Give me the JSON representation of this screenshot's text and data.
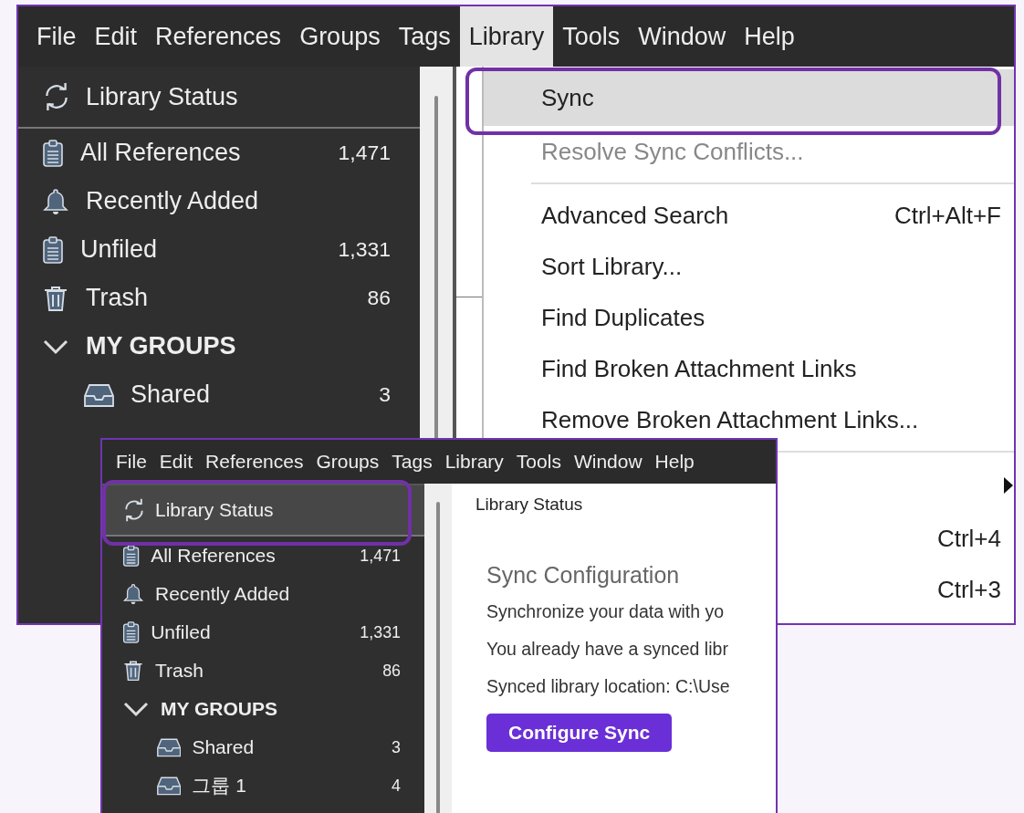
{
  "windows": [
    {
      "menubar": [
        {
          "label": "File",
          "selected": false
        },
        {
          "label": "Edit",
          "selected": false
        },
        {
          "label": "References",
          "selected": false
        },
        {
          "label": "Groups",
          "selected": false
        },
        {
          "label": "Tags",
          "selected": false
        },
        {
          "label": "Library",
          "selected": true
        },
        {
          "label": "Tools",
          "selected": false
        },
        {
          "label": "Window",
          "selected": false
        },
        {
          "label": "Help",
          "selected": false
        }
      ],
      "sidebar": {
        "status_item": {
          "label": "Library Status",
          "selected": false
        },
        "items": [
          {
            "kind": "all",
            "label": "All References",
            "count": "1,471"
          },
          {
            "kind": "recent",
            "label": "Recently Added"
          },
          {
            "kind": "unfiled",
            "label": "Unfiled",
            "count": "1,331"
          },
          {
            "kind": "trash",
            "label": "Trash",
            "count": "86"
          },
          {
            "kind": "header",
            "label": "MY GROUPS",
            "expanded": true,
            "children": [
              {
                "kind": "group",
                "label": "Shared",
                "count": "3"
              }
            ]
          }
        ]
      },
      "menu": {
        "items": [
          {
            "kind": "item",
            "label": "Sync",
            "selected": true,
            "disabled": false,
            "highlighted": true
          },
          {
            "kind": "item",
            "label": "Resolve Sync Conflicts...",
            "selected": false,
            "disabled": true,
            "highlighted": false
          },
          {
            "kind": "separator"
          },
          {
            "kind": "item",
            "label": "Advanced Search",
            "shortcut": "Ctrl+Alt+F",
            "selected": false,
            "disabled": false,
            "highlighted": false
          },
          {
            "kind": "item",
            "label": "Sort Library...",
            "selected": false,
            "disabled": false,
            "highlighted": false
          },
          {
            "kind": "item",
            "label": "Find Duplicates",
            "selected": false,
            "disabled": false,
            "highlighted": false
          },
          {
            "kind": "item",
            "label": "Find Broken Attachment Links",
            "selected": false,
            "disabled": false,
            "highlighted": false
          },
          {
            "kind": "item",
            "label": "Remove Broken Attachment Links...",
            "selected": false,
            "disabled": false,
            "highlighted": false
          },
          {
            "kind": "separator"
          },
          {
            "kind": "submenu"
          },
          {
            "kind": "item",
            "shortcut": "Ctrl+4",
            "selected": false,
            "disabled": false,
            "highlighted": false
          },
          {
            "kind": "item",
            "shortcut": "Ctrl+3",
            "selected": false,
            "disabled": false,
            "highlighted": false
          }
        ]
      }
    },
    {
      "menubar": [
        {
          "label": "File",
          "selected": false
        },
        {
          "label": "Edit",
          "selected": false
        },
        {
          "label": "References",
          "selected": false
        },
        {
          "label": "Groups",
          "selected": false
        },
        {
          "label": "Tags",
          "selected": false
        },
        {
          "label": "Library",
          "selected": false
        },
        {
          "label": "Tools",
          "selected": false
        },
        {
          "label": "Window",
          "selected": false
        },
        {
          "label": "Help",
          "selected": false
        }
      ],
      "sidebar": {
        "status_item": {
          "label": "Library Status",
          "selected": true,
          "highlighted": true
        },
        "items": [
          {
            "kind": "all",
            "label": "All References",
            "count": "1,471"
          },
          {
            "kind": "recent",
            "label": "Recently Added"
          },
          {
            "kind": "unfiled",
            "label": "Unfiled",
            "count": "1,331"
          },
          {
            "kind": "trash",
            "label": "Trash",
            "count": "86"
          },
          {
            "kind": "header",
            "label": "MY GROUPS",
            "expanded": true,
            "children": [
              {
                "kind": "group",
                "label": "Shared",
                "count": "3"
              },
              {
                "kind": "group",
                "label": "그룹 1",
                "count": "4"
              }
            ]
          }
        ]
      },
      "content": {
        "title": "Library Status",
        "heading": "Sync Configuration",
        "paragraphs": [
          "Synchronize your data with yo",
          "You already have a synced libr",
          "Synced library location: C:\\Use"
        ],
        "button": "Configure Sync"
      }
    }
  ]
}
